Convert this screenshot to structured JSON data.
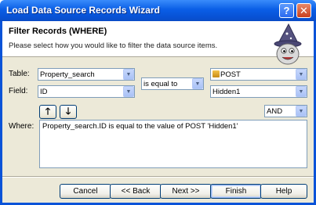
{
  "window": {
    "title": "Load Data Source Records Wizard"
  },
  "header": {
    "title": "Filter Records (WHERE)",
    "subtitle": "Please select how you would like to filter the data source items."
  },
  "form": {
    "table_label": "Table:",
    "field_label": "Field:",
    "where_label": "Where:",
    "table_value": "Property_search",
    "field_value": "ID",
    "operator_value": "is equal to",
    "source_value": "POST",
    "source_field_value": "Hidden1",
    "conjunction_value": "AND",
    "where_text": "Property_search.ID is equal to the value of POST 'Hidden1'",
    "move_up_glyph": "🡑",
    "move_down_glyph": "🡓"
  },
  "buttons": {
    "cancel": "Cancel",
    "back": "<< Back",
    "next": "Next >>",
    "finish": "Finish",
    "help": "Help"
  },
  "icons": {
    "help": "help-icon",
    "close": "close-icon",
    "dropdown": "chevron-down-icon",
    "wizard": "wizard-icon"
  }
}
